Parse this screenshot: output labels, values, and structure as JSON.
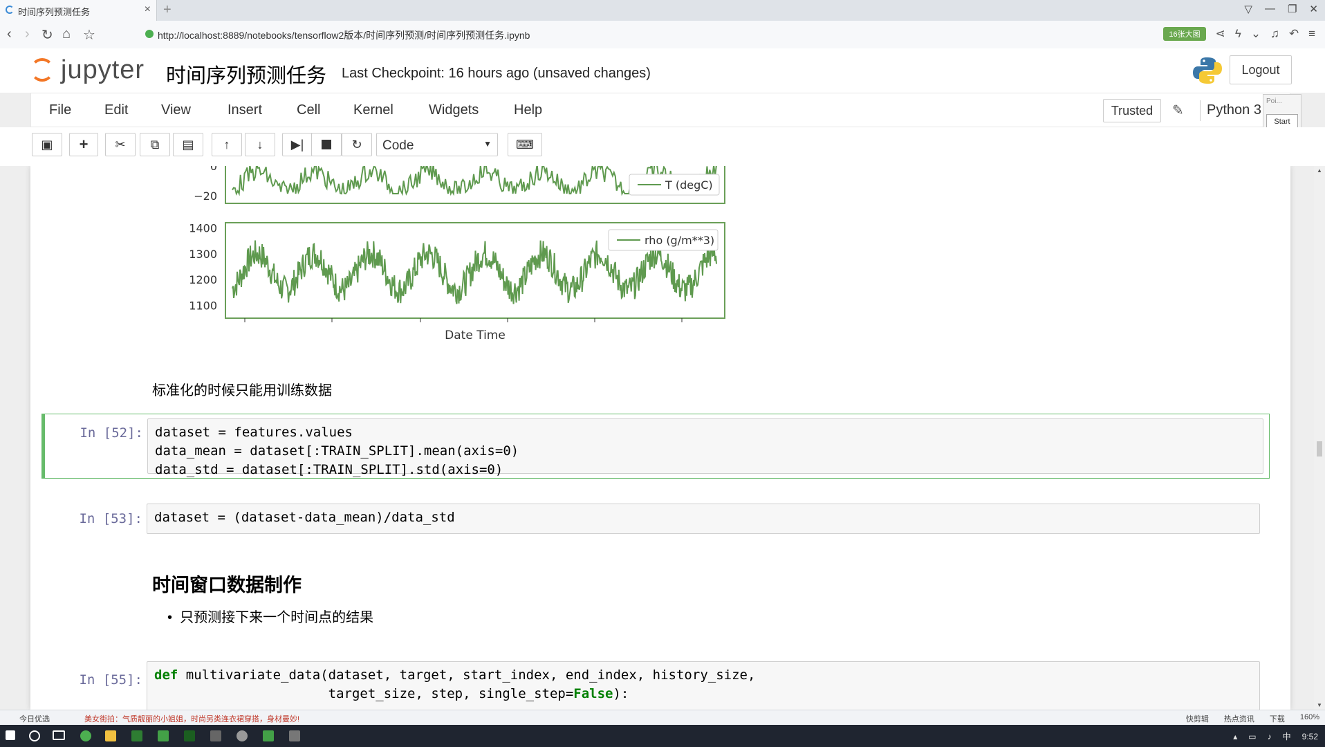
{
  "browser": {
    "tab_title": "时间序列预测任务",
    "tab_close": "×",
    "new_tab": "+",
    "url": "http://localhost:8889/notebooks/tensorflow2版本/时间序列预测/时间序列预测任务.ipynb",
    "speed_badge": "16张大图",
    "window_buttons": [
      "▽",
      "—",
      "❐",
      "✕"
    ]
  },
  "header": {
    "logo_text": "jupyter",
    "notebook_title": "时间序列预测任务",
    "checkpoint": "Last Checkpoint: 16 hours ago (unsaved changes)",
    "logout_label": "Logout"
  },
  "menubar": {
    "items": [
      "File",
      "Edit",
      "View",
      "Insert",
      "Cell",
      "Kernel",
      "Widgets",
      "Help"
    ],
    "trusted_label": "Trusted",
    "kernel_name": "Python 3",
    "popup_label": "Poi...",
    "start_label": "Start"
  },
  "toolbar": {
    "cell_type": "Code"
  },
  "chart_data": [
    {
      "type": "line",
      "series": [
        {
          "name": "T (degC)"
        }
      ],
      "ytick_labels": [
        "0",
        "−20"
      ],
      "legend": "bottom-right"
    },
    {
      "type": "line",
      "series": [
        {
          "name": "rho (g/m**3)"
        }
      ],
      "ytick_labels": [
        "1400",
        "1300",
        "1200",
        "1100"
      ],
      "ylim": [
        1050,
        1420
      ],
      "xlabel": "Date Time",
      "legend": "top-right"
    }
  ],
  "cells": {
    "md1": "标准化的时候只能用训练数据",
    "c52_prompt": "In [52]:",
    "c52_lines": [
      "dataset = features.values",
      "data_mean = dataset[:TRAIN_SPLIT].mean(axis=0)",
      "data_std = dataset[:TRAIN_SPLIT].std(axis=0)"
    ],
    "c53_prompt": "In [53]:",
    "c53_line": "dataset = (dataset-data_mean)/data_std",
    "h2": "时间窗口数据制作",
    "bullet": "只预测接下来一个时间点的结果",
    "c55_prompt": "In [55]:",
    "c55_def": "def",
    "c55_line1": "multivariate_data(dataset, target, start_index, end_index, history_size,",
    "c55_line2a": "                      target_size, step, single_step=",
    "c55_false": "False",
    "c55_line2b": "):"
  },
  "statusbar": {
    "left": "今日优选",
    "news": "美女街拍：气质靓丽的小姐姐，时尚另类连衣裙穿搭，身材曼妙!",
    "right": [
      "快剪辑",
      "热点资讯",
      "下载",
      "160%"
    ]
  },
  "taskbar": {
    "clock": "9:52",
    "ime": "中"
  }
}
